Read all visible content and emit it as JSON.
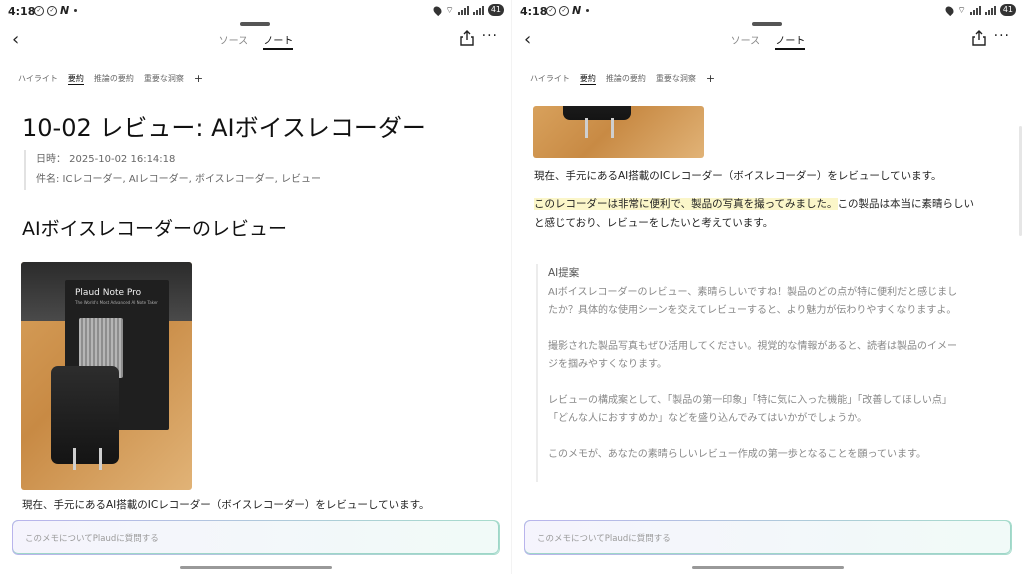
{
  "status": {
    "time": "4:18",
    "battery": "41"
  },
  "topbar": {
    "tab_source": "ソース",
    "tab_note": "ノート",
    "back_icon": "chevron-left-icon",
    "share_icon": "share-icon",
    "more_icon": "more-horizontal-icon"
  },
  "tabs": {
    "items": [
      "ハイライト",
      "要約",
      "推論の要約",
      "重要な洞察"
    ],
    "active": "要約",
    "add_label": "+"
  },
  "note": {
    "title": "10-02 レビュー: AIボイスレコーダー",
    "date_line": "日時： 2025-10-02 16:14:18",
    "subject_line": "件名: ICレコーダー, AIレコーダー, ボイスレコーダー, レビュー",
    "heading": "AIボイスレコーダーのレビュー",
    "photo_brand": "Plaud Note Pro",
    "photo_tagline": "The World's Most Advanced AI Note Taker",
    "para1": "現在、手元にあるAI搭載のICレコーダー（ボイスレコーダー）をレビューしています。",
    "para2_highlight": "このレコーダーは非常に便利で、製品の写真を撮ってみました。",
    "para2_rest_line1": "この製品は本当に素晴らしい",
    "para2_line2": "と感じており、レビューをしたいと考えています。"
  },
  "ai_suggestion": {
    "title": "AI提案",
    "p1_line1": "AIボイスレコーダーのレビュー、素晴らしいですね！製品のどの点が特に便利だと感じまし",
    "p1_line2": "たか？具体的な使用シーンを交えてレビューすると、より魅力が伝わりやすくなりますよ。",
    "p2_line1": "撮影された製品写真もぜひ活用してください。視覚的な情報があると、読者は製品のイメー",
    "p2_line2": "ジを掴みやすくなります。",
    "p3_line1": "レビューの構成案として、「製品の第一印象」「特に気に入った機能」「改善してほしい点」",
    "p3_line2": "「どんな人におすすめか」などを盛り込んでみてはいかがでしょうか。",
    "p4": "このメモが、あなたの素晴らしいレビュー作成の第一歩となることを願っています。"
  },
  "ask": {
    "placeholder": "このメモについてPlaudに質問する"
  }
}
